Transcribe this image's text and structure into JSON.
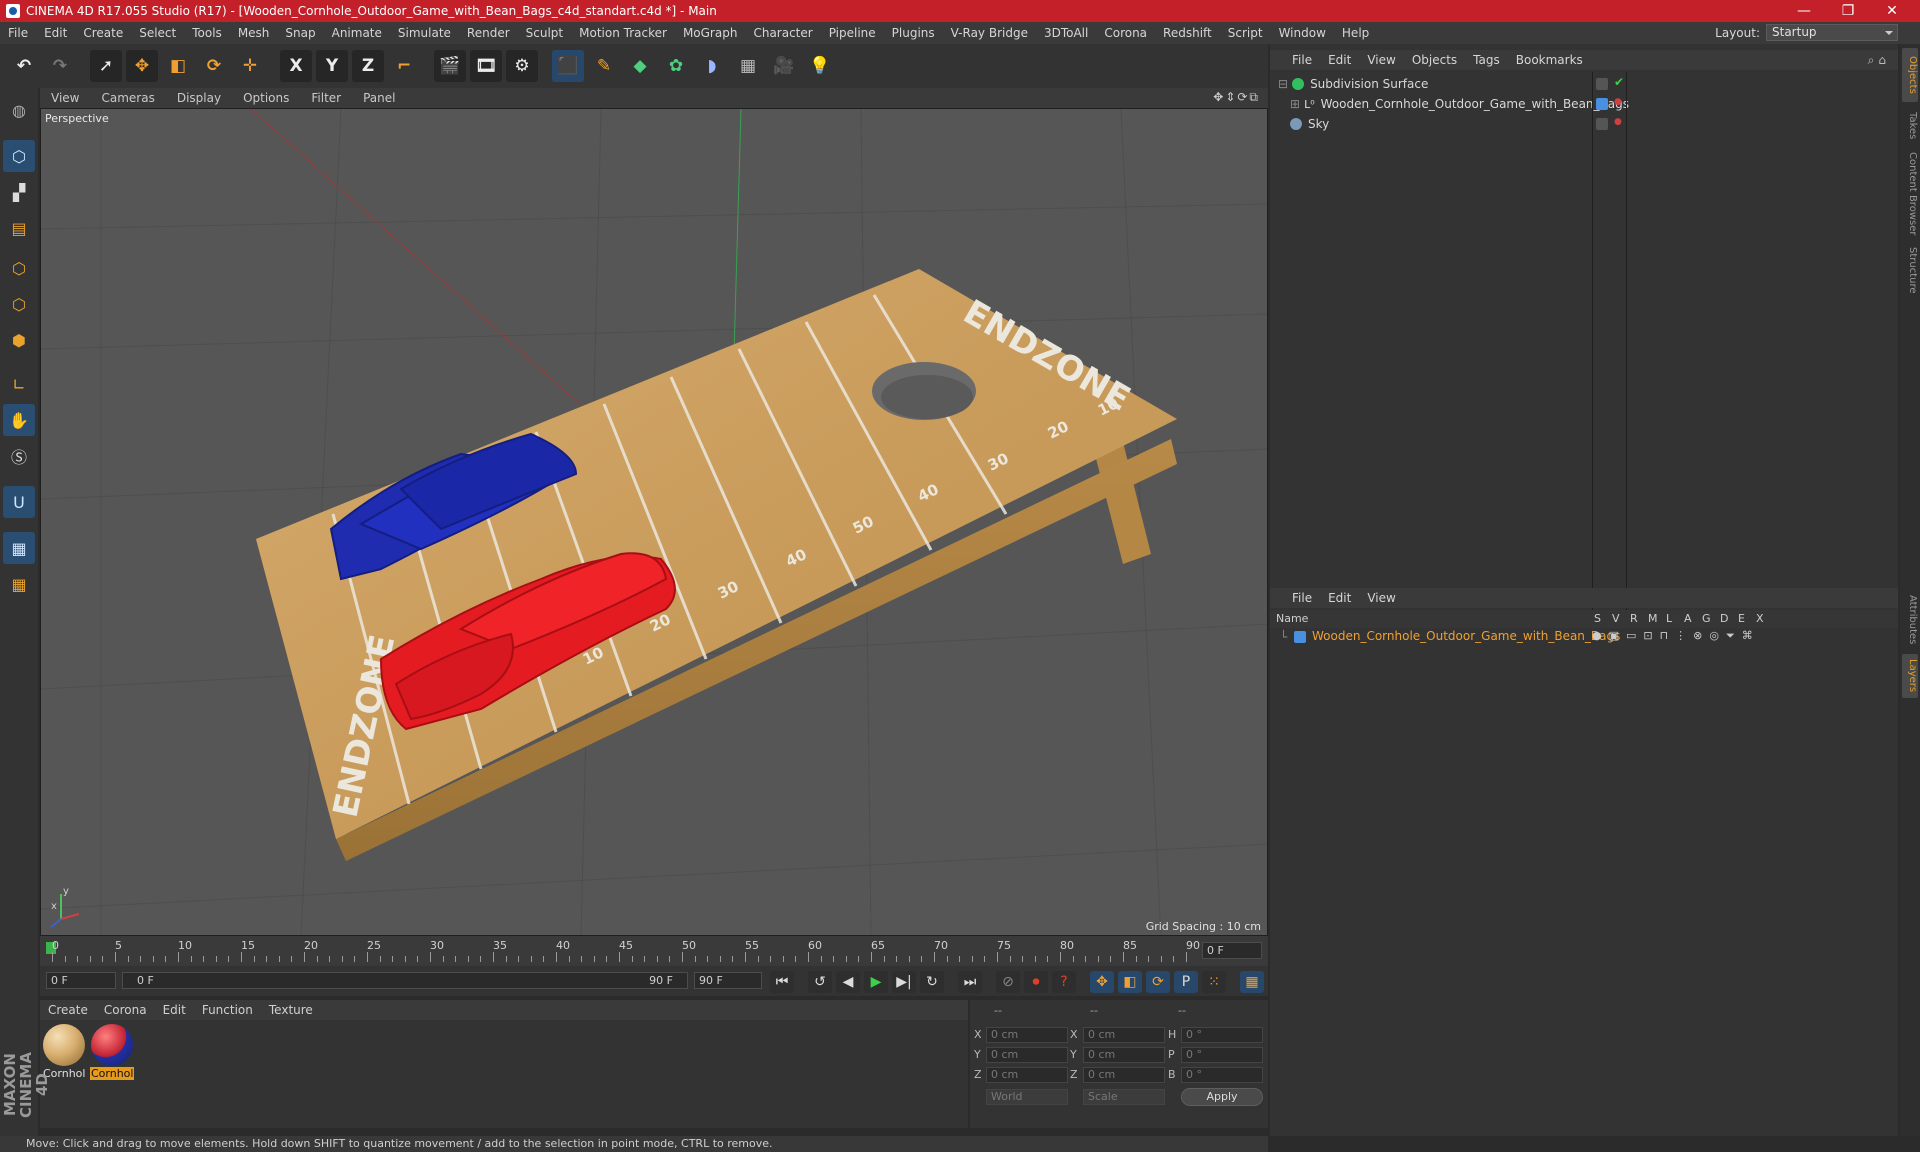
{
  "window": {
    "title": "CINEMA 4D R17.055 Studio (R17) - [Wooden_Cornhole_Outdoor_Game_with_Bean_Bags_c4d_standart.c4d *] - Main",
    "controls": [
      "—",
      "❐",
      "✕"
    ]
  },
  "menu": [
    "File",
    "Edit",
    "Create",
    "Select",
    "Tools",
    "Mesh",
    "Snap",
    "Animate",
    "Simulate",
    "Render",
    "Sculpt",
    "Motion Tracker",
    "MoGraph",
    "Character",
    "Pipeline",
    "Plugins",
    "V-Ray Bridge",
    "3DToAll",
    "Corona",
    "Redshift",
    "Script",
    "Window",
    "Help"
  ],
  "layout": {
    "label": "Layout:",
    "value": "Startup"
  },
  "toolbar": {
    "undo": "↶",
    "redo": "↷",
    "select": "➚",
    "move": "✥",
    "scale": "◧",
    "rotate": "⟳",
    "live": "✛",
    "x_axis": "X",
    "y_axis": "Y",
    "z_axis": "Z",
    "coord": "⌐",
    "render_view": "🎬",
    "render_picture": "🎞",
    "render_settings": "⚙",
    "cube": "⬛",
    "pen": "✎",
    "subdiv": "◆",
    "array": "✿",
    "deformer": "◗",
    "floor": "▦",
    "camera": "🎥",
    "light": "💡"
  },
  "viewport": {
    "menu": [
      "View",
      "Cameras",
      "Display",
      "Options",
      "Filter",
      "Panel"
    ],
    "label": "Perspective",
    "grid_spacing": "Grid Spacing : 10 cm",
    "nav_icons": "✥⇕⟳⧉",
    "axis_x": "x",
    "axis_y": "y",
    "board_text_top": "ENDZONE",
    "board_text_bottom": "ENDZONE",
    "yard_labels": [
      "10",
      "20",
      "30",
      "40",
      "50",
      "40",
      "30",
      "20",
      "10"
    ]
  },
  "timeline": {
    "ticks": [
      "0",
      "5",
      "10",
      "15",
      "20",
      "25",
      "30",
      "35",
      "40",
      "45",
      "50",
      "55",
      "60",
      "65",
      "70",
      "75",
      "80",
      "85",
      "90"
    ],
    "current_frame": "0 F"
  },
  "playbar": {
    "start": "0 F",
    "range_start": "0 F",
    "range_end": "90 F",
    "end": "90 F",
    "buttons": [
      "⏮",
      "↺",
      "◀",
      "▶",
      "▶|",
      "↻",
      "⏭"
    ],
    "tools": [
      "⊘",
      "⏺",
      "?",
      "✥",
      "◧",
      "⟳",
      "P",
      "⁙",
      "▦"
    ]
  },
  "materials": {
    "menu": [
      "Create",
      "Corona",
      "Edit",
      "Function",
      "Texture"
    ],
    "items": [
      {
        "label": "Cornhol",
        "color": "#d9b070"
      },
      {
        "label": "Cornhol",
        "color": "#c02030"
      }
    ]
  },
  "coordinates": {
    "header": [
      "--",
      "--",
      "--"
    ],
    "rows": [
      {
        "a": "X",
        "av": "0 cm",
        "b": "X",
        "bv": "0 cm",
        "c": "H",
        "cv": "0 °"
      },
      {
        "a": "Y",
        "av": "0 cm",
        "b": "Y",
        "bv": "0 cm",
        "c": "P",
        "cv": "0 °"
      },
      {
        "a": "Z",
        "av": "0 cm",
        "b": "Z",
        "bv": "0 cm",
        "c": "B",
        "cv": "0 °"
      }
    ],
    "mode1": "World",
    "mode2": "Scale",
    "apply": "Apply"
  },
  "status": "Move: Click and drag to move elements. Hold down SHIFT to quantize movement / add to the selection in point mode, CTRL to remove.",
  "branding": "MAXON CINEMA 4D",
  "objects": {
    "menu": [
      "File",
      "Edit",
      "View",
      "Objects",
      "Tags",
      "Bookmarks"
    ],
    "items": [
      {
        "name": "Subdivision Surface",
        "color": "#30c060"
      },
      {
        "name": "Wooden_Cornhole_Outdoor_Game_with_Bean_Bags",
        "color": "#4a90e0"
      },
      {
        "name": "Sky",
        "color": "#7a9ab8"
      }
    ]
  },
  "layers": {
    "menu": [
      "File",
      "Edit",
      "View"
    ],
    "name_col": "Name",
    "cols": [
      "S",
      "V",
      "R",
      "M",
      "L",
      "A",
      "G",
      "D",
      "E",
      "X"
    ],
    "item": "Wooden_Cornhole_Outdoor_Game_with_Bean_Bags"
  },
  "sidetabs": [
    "Objects",
    "Takes",
    "Content Browser",
    "Structure",
    "Attributes",
    "Layers"
  ]
}
